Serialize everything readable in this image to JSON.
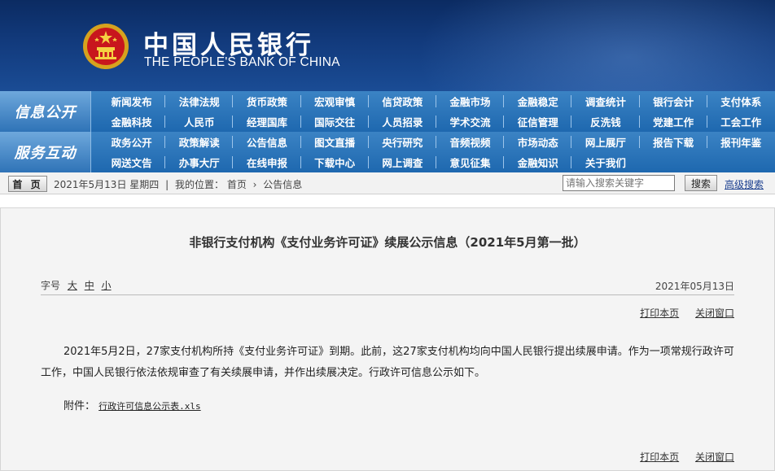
{
  "brand": {
    "cn_name": "中国人民银行",
    "en_name": "THE PEOPLE'S BANK OF CHINA"
  },
  "nav": {
    "section1_label": "信息公开",
    "section2_label": "服务互动",
    "row1": [
      "新闻发布",
      "法律法规",
      "货币政策",
      "宏观审慎",
      "信贷政策",
      "金融市场",
      "金融稳定",
      "调查统计",
      "银行会计",
      "支付体系"
    ],
    "row2": [
      "金融科技",
      "人民币",
      "经理国库",
      "国际交往",
      "人员招录",
      "学术交流",
      "征信管理",
      "反洗钱",
      "党建工作",
      "工会工作"
    ],
    "row3": [
      "政务公开",
      "政策解读",
      "公告信息",
      "图文直播",
      "央行研究",
      "音频视频",
      "市场动态",
      "网上展厅",
      "报告下载",
      "报刊年鉴"
    ],
    "row4": [
      "网送文告",
      "办事大厅",
      "在线申报",
      "下载中心",
      "网上调查",
      "意见征集",
      "金融知识",
      "关于我们"
    ]
  },
  "breadcrumb": {
    "home_button": "首 页",
    "date_text": "2021年5月13日 星期四",
    "location_label": "我的位置：",
    "crumb_home": "首页",
    "crumb_arrow": "›",
    "crumb_current": "公告信息"
  },
  "search": {
    "placeholder": "请输入搜索关键字",
    "button": "搜索",
    "advanced": "高级搜索"
  },
  "article": {
    "title": "非银行支付机构《支付业务许可证》续展公示信息（2021年5月第一批）",
    "font_label": "字号",
    "font_large": "大",
    "font_medium": "中",
    "font_small": "小",
    "date": "2021年05月13日",
    "print": "打印本页",
    "close": "关闭窗口",
    "body": "2021年5月2日，27家支付机构所持《支付业务许可证》到期。此前，这27家支付机构均向中国人民银行提出续展申请。作为一项常规行政许可工作，中国人民银行依法依规审查了有关续展申请，并作出续展决定。行政许可信息公示如下。",
    "attachment_label": "附件：",
    "attachment_file": "行政许可信息公示表.xls"
  },
  "colors": {
    "header_dark": "#0b2b62",
    "nav_blue": "#1e68af",
    "content_bg": "#f4f4f4"
  }
}
